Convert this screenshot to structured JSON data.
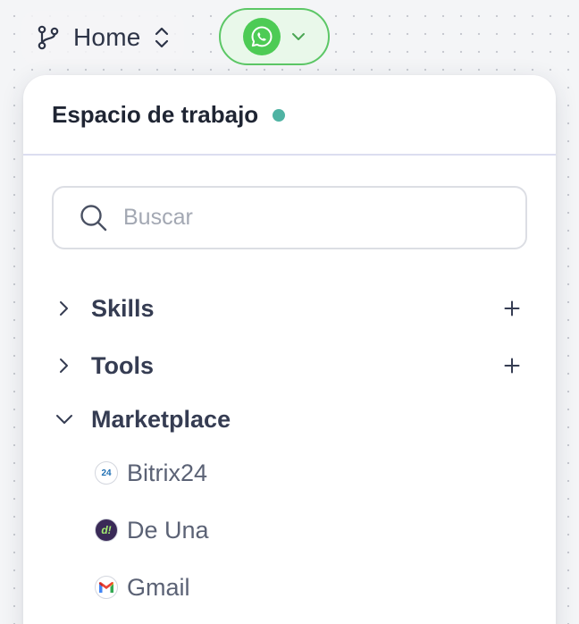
{
  "topbar": {
    "branch_label": "Home",
    "branch_icon": "git-branch-icon",
    "updown_icon": "chevron-up-down-icon",
    "channel_icon": "whatsapp-icon",
    "channel_dropdown_icon": "chevron-down-icon"
  },
  "panel": {
    "title": "Espacio de trabajo",
    "status_color": "#4fb3a3",
    "search": {
      "placeholder": "Buscar",
      "value": ""
    },
    "sections": [
      {
        "label": "Skills",
        "expanded": false,
        "has_add": true
      },
      {
        "label": "Tools",
        "expanded": false,
        "has_add": true
      },
      {
        "label": "Marketplace",
        "expanded": true,
        "has_add": false
      }
    ],
    "marketplace_items": [
      {
        "label": "Bitrix24",
        "logo": "bitrix24-logo",
        "logo_text": "24"
      },
      {
        "label": "De Una",
        "logo": "deuna-logo",
        "logo_text": "d!"
      },
      {
        "label": "Gmail",
        "logo": "gmail-logo"
      }
    ]
  },
  "colors": {
    "accent_green": "#5cc766",
    "whatsapp_green": "#4dcb55",
    "text_dark": "#1f2533",
    "text_muted": "#5b6275"
  }
}
